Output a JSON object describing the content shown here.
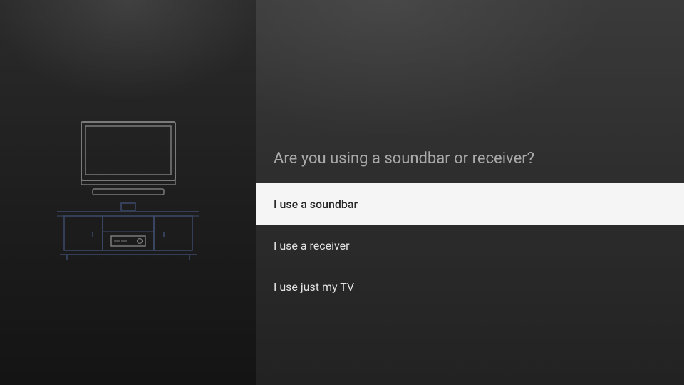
{
  "prompt": {
    "question": "Are you using a soundbar or receiver?"
  },
  "options": [
    {
      "label": "I use a soundbar",
      "selected": true
    },
    {
      "label": "I use a receiver",
      "selected": false
    },
    {
      "label": "I use just my TV",
      "selected": false
    }
  ],
  "illustration": {
    "description": "tv-on-stand-with-soundbar"
  }
}
